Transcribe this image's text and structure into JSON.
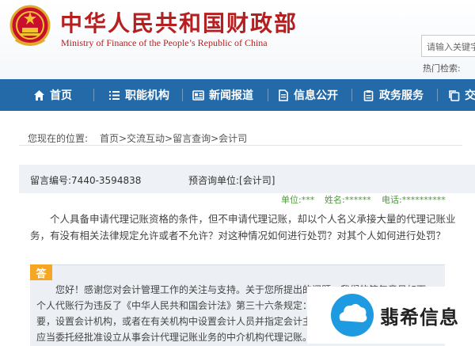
{
  "header": {
    "title_cn": "中华人民共和国财政部",
    "title_en": "Ministry of Finance of the People’s Republic of China",
    "search_placeholder": "请输入关键字",
    "hot_search_label": "热门检索:"
  },
  "nav": {
    "items": [
      {
        "label": "首页",
        "icon": "home-icon"
      },
      {
        "label": "职能机构",
        "icon": "list-icon"
      },
      {
        "label": "新闻报道",
        "icon": "news-icon"
      },
      {
        "label": "信息公开",
        "icon": "document-icon"
      },
      {
        "label": "政务服务",
        "icon": "clipboard-icon"
      },
      {
        "label": "交",
        "icon": "copy-icon"
      }
    ]
  },
  "breadcrumb": {
    "label": "您现在的位置:",
    "path": "首页>交流互动>留言查询>会计司"
  },
  "message": {
    "number": "留言编号:7440-3594838",
    "dept": "预咨询单位:[会计司]",
    "unit": "单位:***",
    "name": "姓名:******",
    "phone": "电话:**********",
    "question": "个人具备申请代理记账资格的条件，但不申请代理记账，却以个人名义承接大量的代理记账业务，有没有相关法律规定允许或者不允许？对这种情况如何进行处罚？对其个人如何进行处罚？"
  },
  "answer": {
    "tag": "答",
    "text": "您好！感谢您对会计管理工作的关注与支持。关于您所提出的问题，我们的答复意见如下：个人代账行为违反了《中华人民共和国会计法》第三十六条规定：各单位应当根据会计业务的需要，设置会计机构，或者在有关机构中设置会计人员并指定会计主管人员；不具备设置条件的，应当委托经批准设立从事会计代理记账业务的中介机构代理记账。"
  },
  "watermark": {
    "text": "翡希信息"
  },
  "colors": {
    "brand_red": "#b51f1f",
    "nav_blue": "#2469a8",
    "meta_green": "#4c9a3a",
    "answer_tag": "#f5a623"
  }
}
